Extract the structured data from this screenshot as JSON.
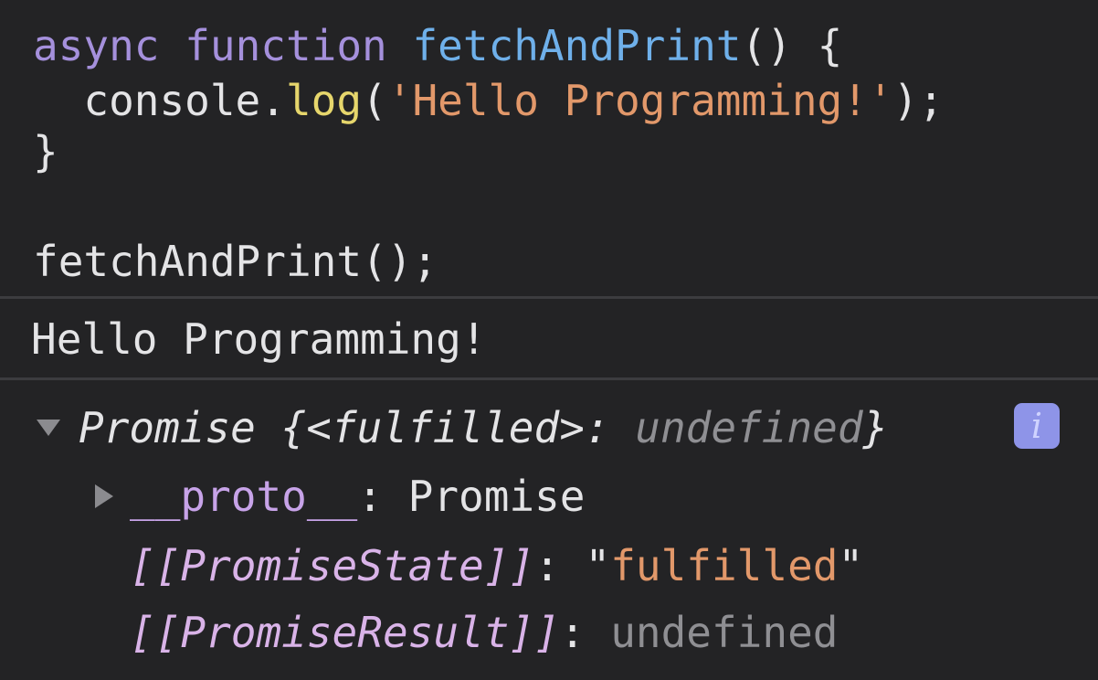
{
  "code": {
    "line1": {
      "kw_async": "async",
      "kw_function": "function",
      "fn_name": "fetchAndPrint",
      "rest": "() {"
    },
    "line2": {
      "object": "console.",
      "method": "log",
      "open": "(",
      "string": "'Hello Programming!'",
      "close": ");"
    },
    "line3": "}",
    "line4": "fetchAndPrint();"
  },
  "output": {
    "text": "Hello Programming!"
  },
  "result": {
    "summary_prefix": "Promise {<fulfilled>: ",
    "summary_value": "undefined",
    "summary_suffix": "}",
    "info_label": "i",
    "proto_key": "__proto__",
    "proto_sep": ": ",
    "proto_value": "Promise",
    "state_key": "[[PromiseState]]",
    "state_sep": ": ",
    "state_value_quote_open": "\"",
    "state_value": "fulfilled",
    "state_value_quote_close": "\"",
    "result_key": "[[PromiseResult]]",
    "result_sep": ": ",
    "result_value": "undefined"
  },
  "colors": {
    "background": "#232325",
    "keyword": "#a590dc",
    "function_name": "#6fb0ea",
    "method": "#e6d66c",
    "string": "#e2986a",
    "info_badge": "#8e94e8"
  }
}
